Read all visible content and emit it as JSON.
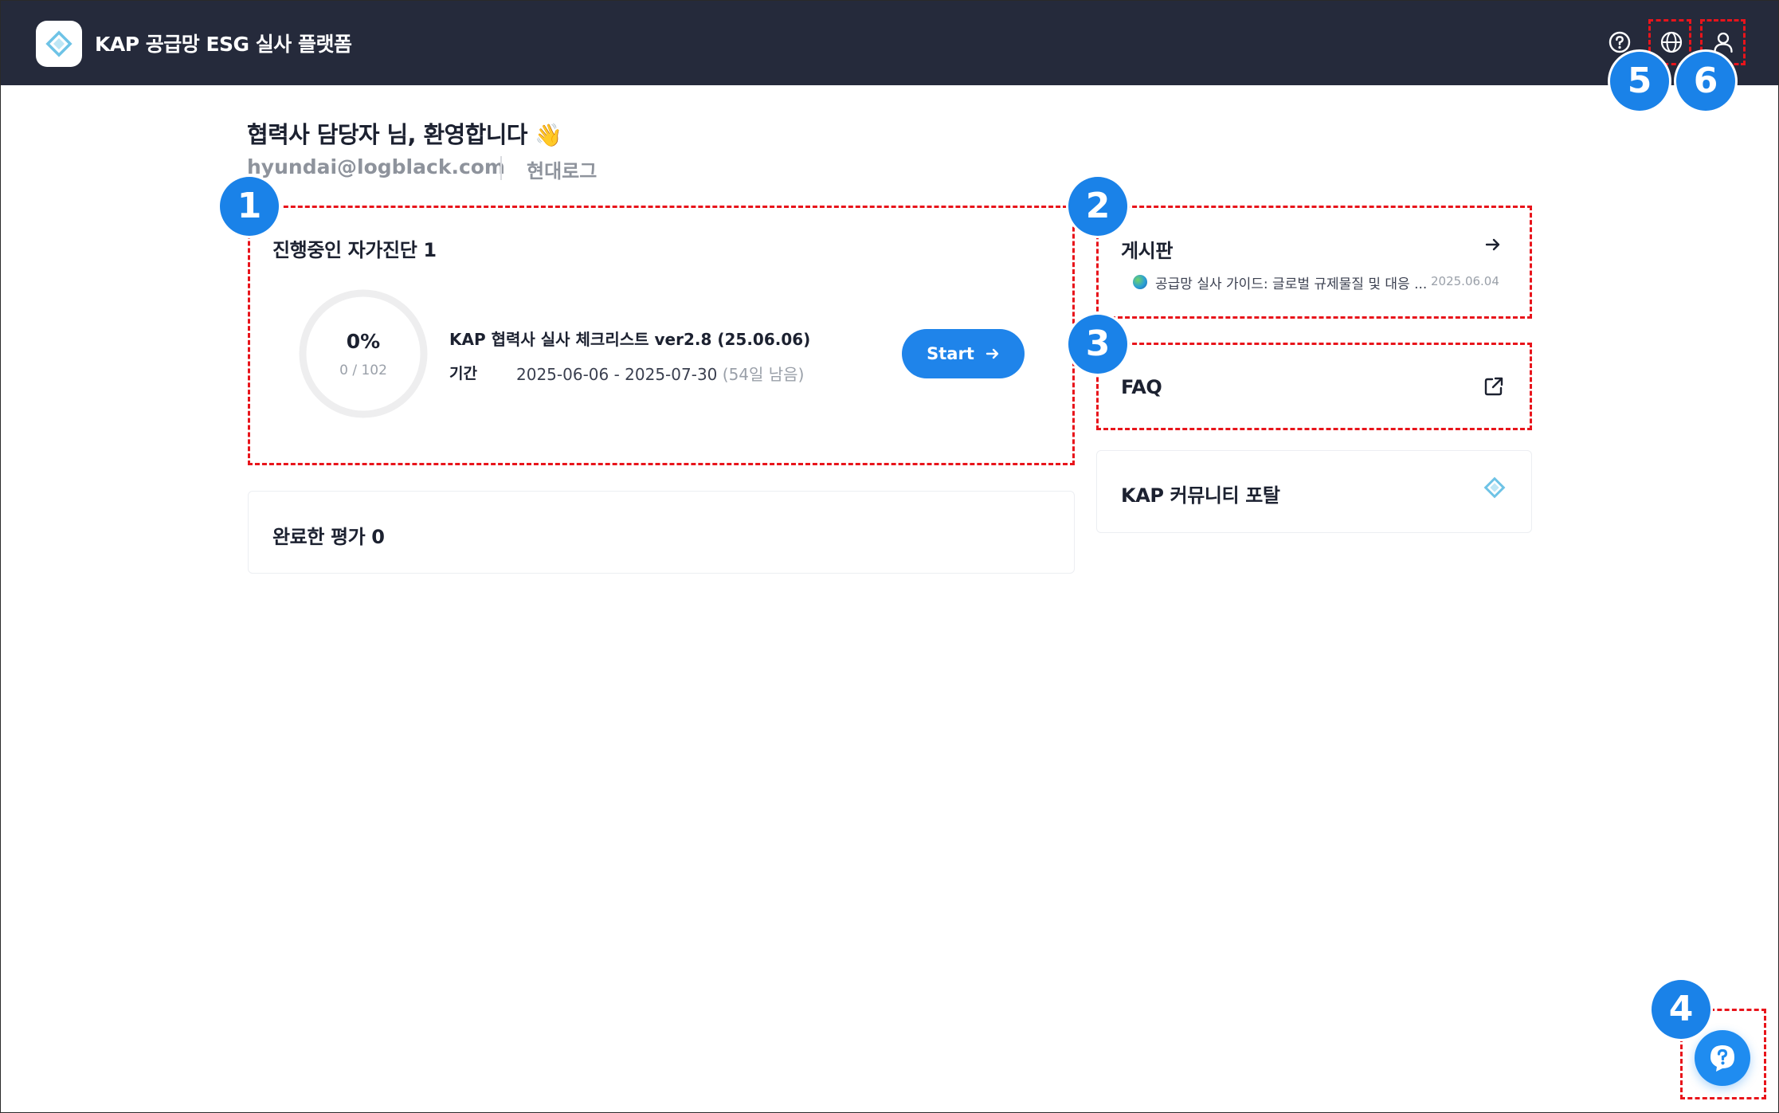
{
  "header": {
    "app_title": "KAP 공급망 ESG 실사 플랫폼",
    "icons": [
      "diamond-logo-icon",
      "help-circle-icon",
      "globe-icon",
      "user-icon"
    ]
  },
  "welcome": {
    "greeting": "협력사 담당자 님, 환영합니다",
    "emoji": "👋",
    "email": "hyundai@logblack.com",
    "company": "현대로그"
  },
  "in_progress": {
    "title": "진행중인 자가진단 1",
    "progress_percent_label": "0%",
    "progress_count": "0 / 102",
    "progress_fraction": 0,
    "checklist_name": "KAP 협력사 실사 체크리스트 ver2.8 (25.06.06)",
    "period_label": "기간",
    "period_value": "2025-06-06 - 2025-07-30",
    "period_remaining": "(54일 남음)",
    "start_label": "Start"
  },
  "completed": {
    "title": "완료한 평가 0"
  },
  "board": {
    "title": "게시판",
    "item_title": "공급망 실사 가이드: 글로벌 규제물질 및 대응 ...",
    "item_date": "2025.06.04"
  },
  "faq": {
    "title": "FAQ"
  },
  "portal": {
    "title": "KAP 커뮤니티 포탈"
  },
  "annotations": {
    "badges": [
      "1",
      "2",
      "3",
      "4",
      "5",
      "6"
    ],
    "marker_color": "#e8141b",
    "badge_color": "#1a82e8"
  },
  "colors": {
    "topbar": "#252a3b",
    "accent": "#1f84ea",
    "text_muted": "#8e939c"
  }
}
